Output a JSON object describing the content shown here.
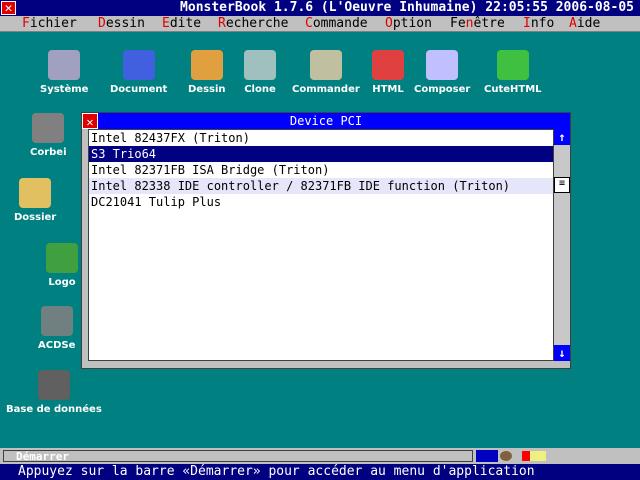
{
  "title": "MonsterBook 1.7.6 (L'Oeuvre Inhumaine) 22:05:55 2006-08-05",
  "menu": [
    {
      "hot": "F",
      "rest": "ichier"
    },
    {
      "hot": "D",
      "rest": "essin"
    },
    {
      "hot": "E",
      "rest": "dite"
    },
    {
      "hot": "R",
      "rest": "echerche"
    },
    {
      "hot": "C",
      "rest": "ommande"
    },
    {
      "hot": "O",
      "rest": "ption"
    },
    {
      "pre": "Fe",
      "hot": "n",
      "rest": "être"
    },
    {
      "hot": "I",
      "rest": "nfo"
    },
    {
      "hot": "A",
      "rest": "ide"
    }
  ],
  "desktop_icons": [
    "Système",
    "Document",
    "Dessin",
    "Clone",
    "Commander",
    "HTML",
    "Composer",
    "CuteHTML",
    "Corbei",
    "Dossier",
    "Logo",
    "ACDSe",
    "Base de données"
  ],
  "window": {
    "title": "Device PCI",
    "items": [
      "Intel 82437FX (Triton)",
      "S3 Trio64",
      "Intel 82371FB ISA Bridge (Triton)",
      "Intel 82338 IDE controller / 82371FB IDE function (Triton)",
      "DC21041 Tulip Plus"
    ],
    "selected": 1
  },
  "taskbar": {
    "start": "Démarrer"
  },
  "status": "Appuyez sur la barre «Démarrer» pour accéder au menu d'application"
}
